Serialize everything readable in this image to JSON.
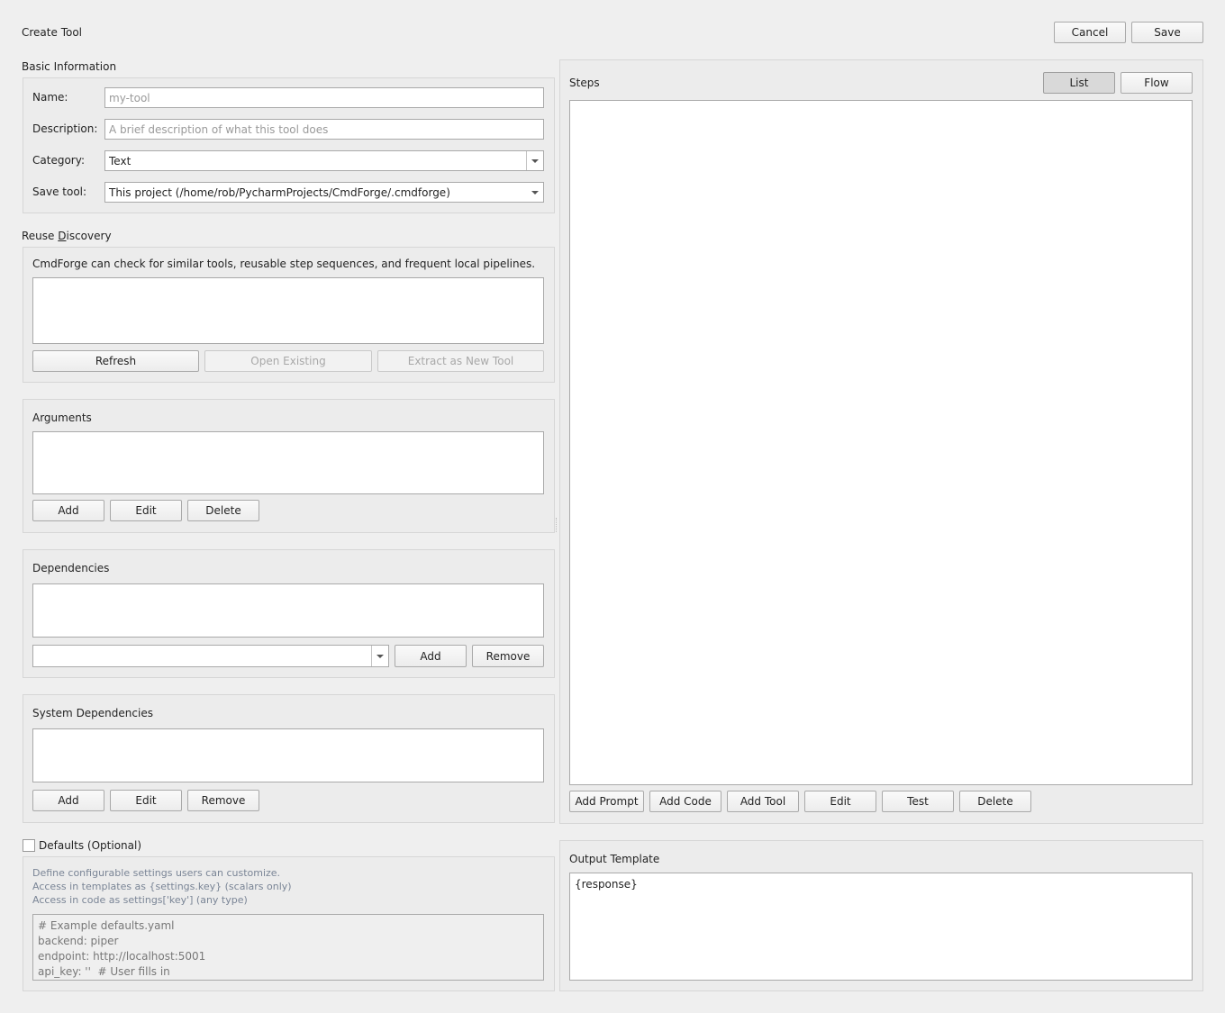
{
  "window": {
    "title": "Create Tool"
  },
  "header": {
    "cancel_label": "Cancel",
    "save_label": "Save"
  },
  "basic_info": {
    "title": "Basic Information",
    "name_label": "Name:",
    "name_placeholder": "my-tool",
    "name_value": "",
    "description_label": "Description:",
    "description_placeholder": "A brief description of what this tool does",
    "description_value": "",
    "category_label": "Category:",
    "category_value": "Text",
    "save_tool_label": "Save tool:",
    "save_tool_value": "This project (/home/rob/PycharmProjects/CmdForge/.cmdforge)"
  },
  "reuse": {
    "title": "Reuse ",
    "title_mnemonic": "D",
    "title_rest": "iscovery",
    "description": "CmdForge can check for similar tools, reusable step sequences, and frequent local pipelines.",
    "refresh_label": "Refresh",
    "open_existing_label": "Open Existing",
    "extract_label": "Extract as New Tool"
  },
  "arguments": {
    "title": "Arguments",
    "add_label": "Add",
    "edit_label": "Edit",
    "delete_label": "Delete"
  },
  "dependencies": {
    "title": "Dependencies",
    "combo_value": "",
    "add_label": "Add",
    "remove_label": "Remove"
  },
  "system_dependencies": {
    "title": "System Dependencies",
    "add_label": "Add",
    "edit_label": "Edit",
    "remove_label": "Remove"
  },
  "defaults": {
    "checkbox_label": "Defaults (Optional)",
    "checked": false,
    "hint_line1": "Define configurable settings users can customize.",
    "hint_line2": "Access in templates as {settings.key} (scalars only)",
    "hint_line3": "Access in code as settings['key'] (any type)",
    "yaml_example": "# Example defaults.yaml\nbackend: piper\nendpoint: http://localhost:5001\napi_key: ''  # User fills in"
  },
  "steps": {
    "title": "Steps",
    "view_list_label": "List",
    "view_flow_label": "Flow",
    "active_view": "List",
    "add_prompt_label": "Add Prompt",
    "add_code_label": "Add Code",
    "add_tool_label": "Add Tool",
    "edit_label": "Edit",
    "test_label": "Test",
    "delete_label": "Delete"
  },
  "output": {
    "title": "Output Template",
    "value": "{response}"
  }
}
